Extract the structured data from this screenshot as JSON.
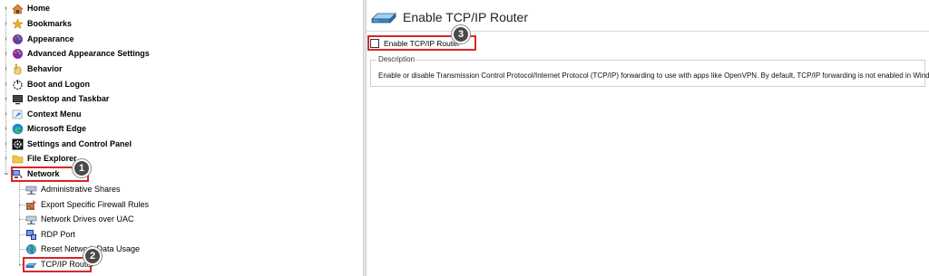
{
  "tree": {
    "items": [
      {
        "label": "Home",
        "icon": "home-icon"
      },
      {
        "label": "Bookmarks",
        "icon": "star-icon"
      },
      {
        "label": "Appearance",
        "icon": "palette-icon"
      },
      {
        "label": "Advanced Appearance Settings",
        "icon": "palette-icon"
      },
      {
        "label": "Behavior",
        "icon": "hand-icon"
      },
      {
        "label": "Boot and Logon",
        "icon": "power-icon"
      },
      {
        "label": "Desktop and Taskbar",
        "icon": "desktop-icon"
      },
      {
        "label": "Context Menu",
        "icon": "menu-icon"
      },
      {
        "label": "Microsoft Edge",
        "icon": "edge-icon"
      },
      {
        "label": "Settings and Control Panel",
        "icon": "gear-icon"
      },
      {
        "label": "File Explorer",
        "icon": "folder-icon"
      },
      {
        "label": "Network",
        "icon": "network-icon"
      }
    ],
    "network_children": [
      {
        "label": "Administrative Shares",
        "icon": "share-icon"
      },
      {
        "label": "Export Specific Firewall Rules",
        "icon": "firewall-icon"
      },
      {
        "label": "Network Drives over UAC",
        "icon": "drive-icon"
      },
      {
        "label": "RDP Port",
        "icon": "rdp-icon"
      },
      {
        "label": "Reset Network Data Usage",
        "icon": "globe-icon"
      },
      {
        "label": "TCP/IP Router",
        "icon": "router-icon"
      }
    ]
  },
  "callouts": {
    "one": "1",
    "two": "2",
    "three": "3"
  },
  "panel": {
    "title": "Enable TCP/IP Router",
    "checkbox_label": "Enable TCP/IP Router",
    "checkbox_checked": false,
    "description_legend": "Description",
    "description_text": "Enable or disable Transmission Control Protocol/Internet Protocol (TCP/IP) forwarding to use with apps like OpenVPN. By default, TCP/IP forwarding is not enabled in Windows OS."
  },
  "colors": {
    "highlight": "#d9252a",
    "badge": "#4a4a4a"
  }
}
